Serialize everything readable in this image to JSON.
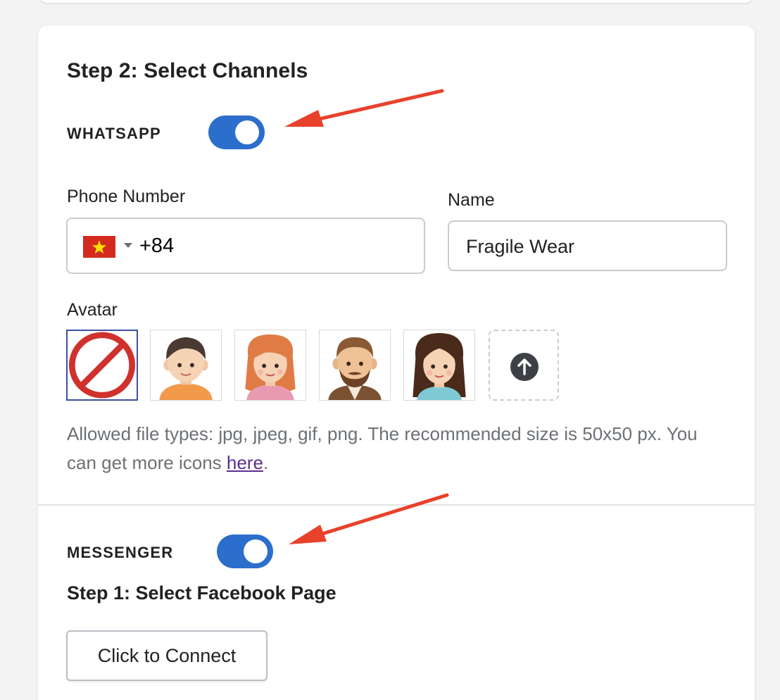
{
  "section": {
    "title": "Step 2: Select Channels"
  },
  "whatsapp": {
    "label": "WHATSAPP",
    "enabled": true,
    "phone": {
      "label": "Phone Number",
      "country_flag": "vietnam-flag",
      "dial_code": "+84"
    },
    "name": {
      "label": "Name",
      "value": "Fragile Wear"
    },
    "avatar": {
      "label": "Avatar",
      "options": [
        "none-icon",
        "man-avatar",
        "woman-redhair-avatar",
        "bearded-man-avatar",
        "woman-darkhair-avatar"
      ],
      "selected": "none-icon",
      "upload_icon": "upload-arrow-icon"
    },
    "help": {
      "text": "Allowed file types: jpg, jpeg, gif, png. The recommended size is 50x50 px. You can get more icons ",
      "link": "here",
      "suffix": "."
    }
  },
  "messenger": {
    "label": "MESSENGER",
    "enabled": true,
    "step_title": "Step 1: Select Facebook Page",
    "connect_button": "Click to Connect"
  },
  "colors": {
    "toggle": "#2c6ecb",
    "annotation_arrow": "#e8412c",
    "link": "#5c2d91"
  }
}
